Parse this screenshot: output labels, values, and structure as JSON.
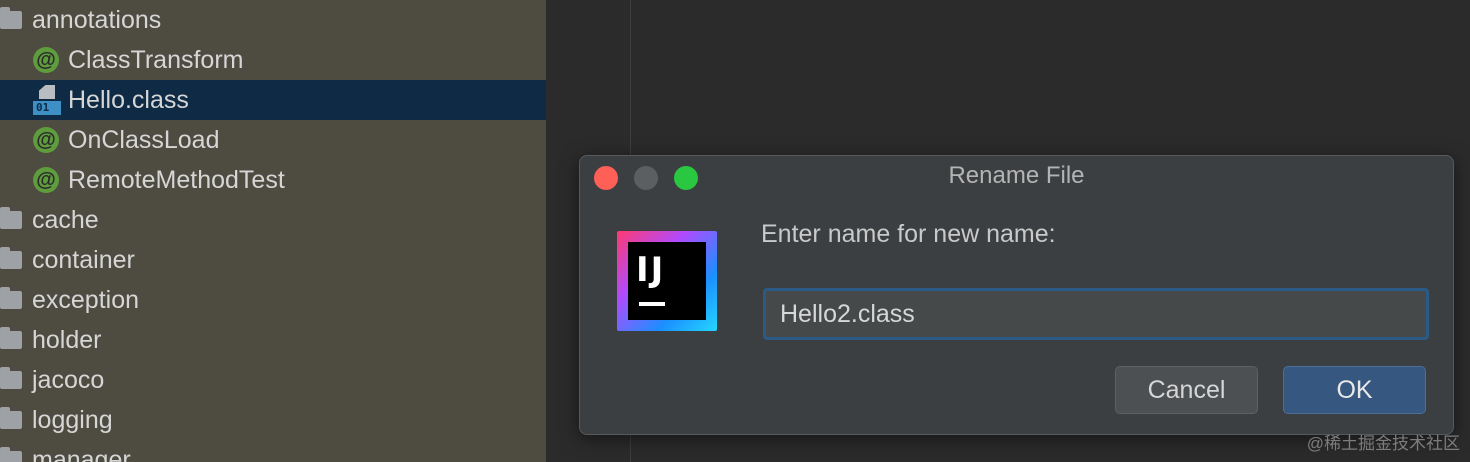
{
  "tree": {
    "items": [
      {
        "label": "annotations",
        "type": "folder"
      },
      {
        "label": "ClassTransform",
        "type": "annotation"
      },
      {
        "label": "Hello.class",
        "type": "classfile",
        "selected": true
      },
      {
        "label": "OnClassLoad",
        "type": "annotation"
      },
      {
        "label": "RemoteMethodTest",
        "type": "annotation"
      },
      {
        "label": "cache",
        "type": "folder"
      },
      {
        "label": "container",
        "type": "folder"
      },
      {
        "label": "exception",
        "type": "folder"
      },
      {
        "label": "holder",
        "type": "folder"
      },
      {
        "label": "jacoco",
        "type": "folder"
      },
      {
        "label": "logging",
        "type": "folder"
      },
      {
        "label": "manager",
        "type": "folder"
      }
    ],
    "annotation_glyph": "@",
    "classfile_glyph": "01"
  },
  "dialog": {
    "title": "Rename File",
    "prompt": "Enter name for new name:",
    "input_value": "Hello2.class",
    "cancel_label": "Cancel",
    "ok_label": "OK",
    "logo_text": "IJ"
  },
  "watermark": "@稀土掘金技术社区",
  "colors": {
    "tree_bg": "#4e4b40",
    "selection": "#0e2a44",
    "annotation_icon": "#5f9c3d",
    "ok_button": "#365880",
    "close_dot": "#fe5f57",
    "max_dot": "#29c840"
  }
}
